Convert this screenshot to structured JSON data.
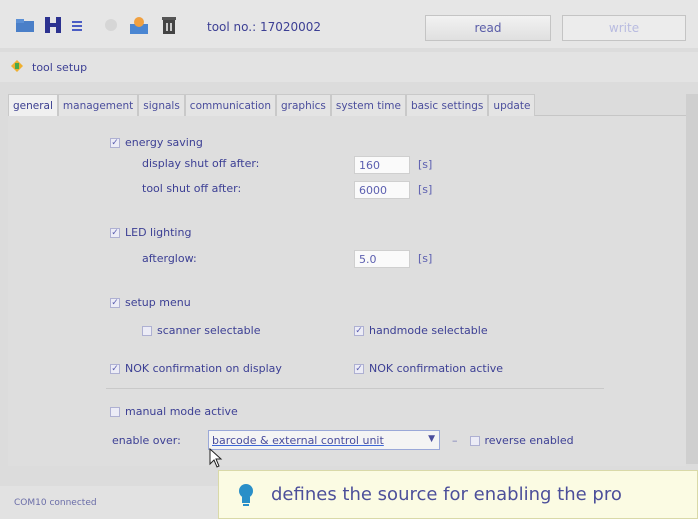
{
  "toolbar": {
    "icons": [
      "folder-icon",
      "save-icon",
      "list-icon",
      "disabled-icon",
      "user-icon",
      "trash-icon"
    ],
    "tool_no_label": "tool no.: 17020002",
    "read_label": "read",
    "write_label": "write"
  },
  "breadcrumb": {
    "icon": "setup-icon",
    "label": "tool setup"
  },
  "tabs": [
    {
      "label": "general",
      "active": true
    },
    {
      "label": "management",
      "active": false
    },
    {
      "label": "signals",
      "active": false
    },
    {
      "label": "communication",
      "active": false
    },
    {
      "label": "graphics",
      "active": false
    },
    {
      "label": "system time",
      "active": false
    },
    {
      "label": "basic settings",
      "active": false
    },
    {
      "label": "update",
      "active": false
    }
  ],
  "general": {
    "energy_saving": {
      "label": "energy saving",
      "checked": true
    },
    "display_shut_off": {
      "label": "display shut off after:",
      "value": "160",
      "unit": "[s]"
    },
    "tool_shut_off": {
      "label": "tool shut off after:",
      "value": "6000",
      "unit": "[s]"
    },
    "led_lighting": {
      "label": "LED lighting",
      "checked": true
    },
    "afterglow": {
      "label": "afterglow:",
      "value": "5.0",
      "unit": "[s]"
    },
    "setup_menu": {
      "label": "setup menu",
      "checked": true
    },
    "scanner_selectable": {
      "label": "scanner selectable",
      "checked": false
    },
    "handmode_selectable": {
      "label": "handmode selectable",
      "checked": true
    },
    "nok_confirmation_display": {
      "label": "NOK confirmation on display",
      "checked": true
    },
    "nok_confirmation_active": {
      "label": "NOK confirmation active",
      "checked": true
    },
    "manual_mode_active": {
      "label": "manual mode active",
      "checked": false
    },
    "enable_over": {
      "label": "enable over:",
      "selected": "barcode & external control unit"
    },
    "reverse_enabled": {
      "label": "reverse enabled",
      "checked": false
    }
  },
  "status": {
    "text": "COM10 connected"
  },
  "tooltip": {
    "text": "defines the source for enabling the pro"
  },
  "colors": {
    "accent": "#3a3d8f",
    "tooltip_bg": "#fbfbe3",
    "panel_bg": "#dedede"
  }
}
